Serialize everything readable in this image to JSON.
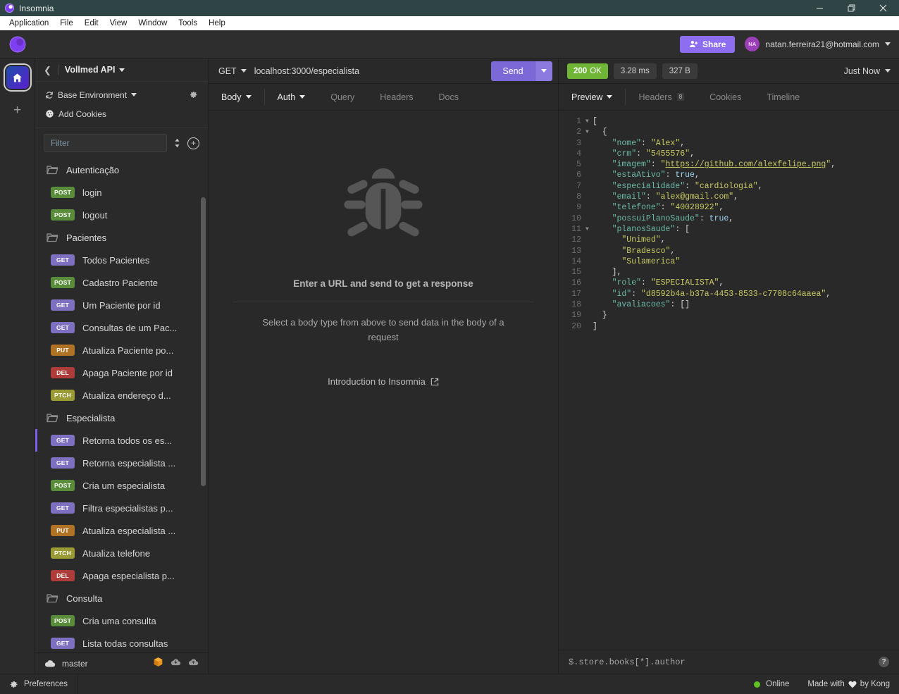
{
  "window": {
    "title": "Insomnia",
    "minimize": "minimize-icon",
    "maximize": "restore-icon",
    "close": "close-icon"
  },
  "menubar": [
    "Application",
    "File",
    "Edit",
    "View",
    "Window",
    "Tools",
    "Help"
  ],
  "toolbar": {
    "share_label": "Share",
    "avatar_initials": "NA",
    "account_email": "natan.ferreira21@hotmail.com"
  },
  "rail": {
    "home": "home-icon",
    "add": "+"
  },
  "sidebar": {
    "workspace": "Vollmed API",
    "environment": "Base Environment",
    "cookies": "Add Cookies",
    "filter_placeholder": "Filter",
    "branch": "master",
    "tree": [
      {
        "type": "folder",
        "name": "Autenticação"
      },
      {
        "type": "request",
        "method": "POST",
        "name": "login"
      },
      {
        "type": "request",
        "method": "POST",
        "name": "logout"
      },
      {
        "type": "folder",
        "name": "Pacientes"
      },
      {
        "type": "request",
        "method": "GET",
        "name": "Todos Pacientes"
      },
      {
        "type": "request",
        "method": "POST",
        "name": "Cadastro Paciente"
      },
      {
        "type": "request",
        "method": "GET",
        "name": "Um Paciente por id"
      },
      {
        "type": "request",
        "method": "GET",
        "name": "Consultas de um Pac..."
      },
      {
        "type": "request",
        "method": "PUT",
        "name": "Atualiza Paciente po..."
      },
      {
        "type": "request",
        "method": "DEL",
        "name": "Apaga Paciente por id"
      },
      {
        "type": "request",
        "method": "PTCH",
        "name": "Atualiza endereço d..."
      },
      {
        "type": "folder",
        "name": "Especialista"
      },
      {
        "type": "request",
        "method": "GET",
        "name": "Retorna todos os es...",
        "active": true
      },
      {
        "type": "request",
        "method": "GET",
        "name": "Retorna especialista ..."
      },
      {
        "type": "request",
        "method": "POST",
        "name": "Cria um especialista"
      },
      {
        "type": "request",
        "method": "GET",
        "name": "Filtra especialistas p..."
      },
      {
        "type": "request",
        "method": "PUT",
        "name": "Atualiza especialista ..."
      },
      {
        "type": "request",
        "method": "PTCH",
        "name": "Atualiza telefone"
      },
      {
        "type": "request",
        "method": "DEL",
        "name": "Apaga especialista p..."
      },
      {
        "type": "folder",
        "name": "Consulta"
      },
      {
        "type": "request",
        "method": "POST",
        "name": "Cria uma consulta"
      },
      {
        "type": "request",
        "method": "GET",
        "name": "Lista todas consultas"
      }
    ]
  },
  "method_colors": {
    "GET": "#7e6fc0",
    "POST": "#5a8d3b",
    "PUT": "#b07225",
    "DEL": "#b03b3b",
    "PTCH": "#9a9b34"
  },
  "request": {
    "method": "GET",
    "url": "localhost:3000/especialista",
    "send_label": "Send",
    "tabs": [
      {
        "label": "Body",
        "dropdown": true,
        "bright": true
      },
      {
        "label": "Auth",
        "dropdown": true,
        "bright": true
      },
      {
        "label": "Query",
        "dropdown": false,
        "bright": false
      },
      {
        "label": "Headers",
        "dropdown": false,
        "bright": false
      },
      {
        "label": "Docs",
        "dropdown": false,
        "bright": false
      }
    ],
    "empty_title": "Enter a URL and send to get a response",
    "empty_subtitle": "Select a body type from above to send data in the body of a request",
    "empty_link": "Introduction to Insomnia"
  },
  "response": {
    "status_code": "200",
    "status_text": "OK",
    "time": "3.28 ms",
    "size": "327 B",
    "timestamp": "Just Now",
    "tabs": [
      {
        "label": "Preview",
        "dropdown": true,
        "active": true,
        "badge": ""
      },
      {
        "label": "Headers",
        "dropdown": false,
        "active": false,
        "badge": "8"
      },
      {
        "label": "Cookies",
        "dropdown": false,
        "active": false,
        "badge": ""
      },
      {
        "label": "Timeline",
        "dropdown": false,
        "active": false,
        "badge": ""
      }
    ],
    "jsonpath_placeholder": "$.store.books[*].author",
    "body_lines": [
      {
        "n": 1,
        "fold": true,
        "tokens": [
          {
            "t": "p",
            "v": "["
          }
        ]
      },
      {
        "n": 2,
        "fold": true,
        "tokens": [
          {
            "t": "p",
            "v": "  {"
          }
        ]
      },
      {
        "n": 3,
        "fold": false,
        "tokens": [
          {
            "t": "k",
            "v": "    \"nome\""
          },
          {
            "t": "p",
            "v": ": "
          },
          {
            "t": "s",
            "v": "\"Alex\""
          },
          {
            "t": "p",
            "v": ","
          }
        ]
      },
      {
        "n": 4,
        "fold": false,
        "tokens": [
          {
            "t": "k",
            "v": "    \"crm\""
          },
          {
            "t": "p",
            "v": ": "
          },
          {
            "t": "s",
            "v": "\"5455576\""
          },
          {
            "t": "p",
            "v": ","
          }
        ]
      },
      {
        "n": 5,
        "fold": false,
        "tokens": [
          {
            "t": "k",
            "v": "    \"imagem\""
          },
          {
            "t": "p",
            "v": ": "
          },
          {
            "t": "s",
            "v": "\""
          },
          {
            "t": "lnk",
            "v": "https://github.com/alexfelipe.png"
          },
          {
            "t": "s",
            "v": "\""
          },
          {
            "t": "p",
            "v": ","
          }
        ]
      },
      {
        "n": 6,
        "fold": false,
        "tokens": [
          {
            "t": "k",
            "v": "    \"estaAtivo\""
          },
          {
            "t": "p",
            "v": ": "
          },
          {
            "t": "b",
            "v": "true"
          },
          {
            "t": "p",
            "v": ","
          }
        ]
      },
      {
        "n": 7,
        "fold": false,
        "tokens": [
          {
            "t": "k",
            "v": "    \"especialidade\""
          },
          {
            "t": "p",
            "v": ": "
          },
          {
            "t": "s",
            "v": "\"cardiologia\""
          },
          {
            "t": "p",
            "v": ","
          }
        ]
      },
      {
        "n": 8,
        "fold": false,
        "tokens": [
          {
            "t": "k",
            "v": "    \"email\""
          },
          {
            "t": "p",
            "v": ": "
          },
          {
            "t": "s",
            "v": "\"alex@gmail.com\""
          },
          {
            "t": "p",
            "v": ","
          }
        ]
      },
      {
        "n": 9,
        "fold": false,
        "tokens": [
          {
            "t": "k",
            "v": "    \"telefone\""
          },
          {
            "t": "p",
            "v": ": "
          },
          {
            "t": "s",
            "v": "\"40028922\""
          },
          {
            "t": "p",
            "v": ","
          }
        ]
      },
      {
        "n": 10,
        "fold": false,
        "tokens": [
          {
            "t": "k",
            "v": "    \"possuiPlanoSaude\""
          },
          {
            "t": "p",
            "v": ": "
          },
          {
            "t": "b",
            "v": "true"
          },
          {
            "t": "p",
            "v": ","
          }
        ]
      },
      {
        "n": 11,
        "fold": true,
        "tokens": [
          {
            "t": "k",
            "v": "    \"planosSaude\""
          },
          {
            "t": "p",
            "v": ": ["
          }
        ]
      },
      {
        "n": 12,
        "fold": false,
        "tokens": [
          {
            "t": "s",
            "v": "      \"Unimed\""
          },
          {
            "t": "p",
            "v": ","
          }
        ]
      },
      {
        "n": 13,
        "fold": false,
        "tokens": [
          {
            "t": "s",
            "v": "      \"Bradesco\""
          },
          {
            "t": "p",
            "v": ","
          }
        ]
      },
      {
        "n": 14,
        "fold": false,
        "tokens": [
          {
            "t": "s",
            "v": "      \"Sulamerica\""
          }
        ]
      },
      {
        "n": 15,
        "fold": false,
        "tokens": [
          {
            "t": "p",
            "v": "    ],"
          }
        ]
      },
      {
        "n": 16,
        "fold": false,
        "tokens": [
          {
            "t": "k",
            "v": "    \"role\""
          },
          {
            "t": "p",
            "v": ": "
          },
          {
            "t": "s",
            "v": "\"ESPECIALISTA\""
          },
          {
            "t": "p",
            "v": ","
          }
        ]
      },
      {
        "n": 17,
        "fold": false,
        "tokens": [
          {
            "t": "k",
            "v": "    \"id\""
          },
          {
            "t": "p",
            "v": ": "
          },
          {
            "t": "s",
            "v": "\"d8592b4a-b37a-4453-8533-c7708c64aaea\""
          },
          {
            "t": "p",
            "v": ","
          }
        ]
      },
      {
        "n": 18,
        "fold": false,
        "tokens": [
          {
            "t": "k",
            "v": "    \"avaliacoes\""
          },
          {
            "t": "p",
            "v": ": "
          },
          {
            "t": "p",
            "v": "[]"
          }
        ]
      },
      {
        "n": 19,
        "fold": false,
        "tokens": [
          {
            "t": "p",
            "v": "  }"
          }
        ]
      },
      {
        "n": 20,
        "fold": false,
        "tokens": [
          {
            "t": "p",
            "v": "]"
          }
        ]
      }
    ]
  },
  "statusbar": {
    "preferences": "Preferences",
    "online": "Online",
    "made_prefix": "Made with",
    "made_suffix": "by Kong"
  }
}
